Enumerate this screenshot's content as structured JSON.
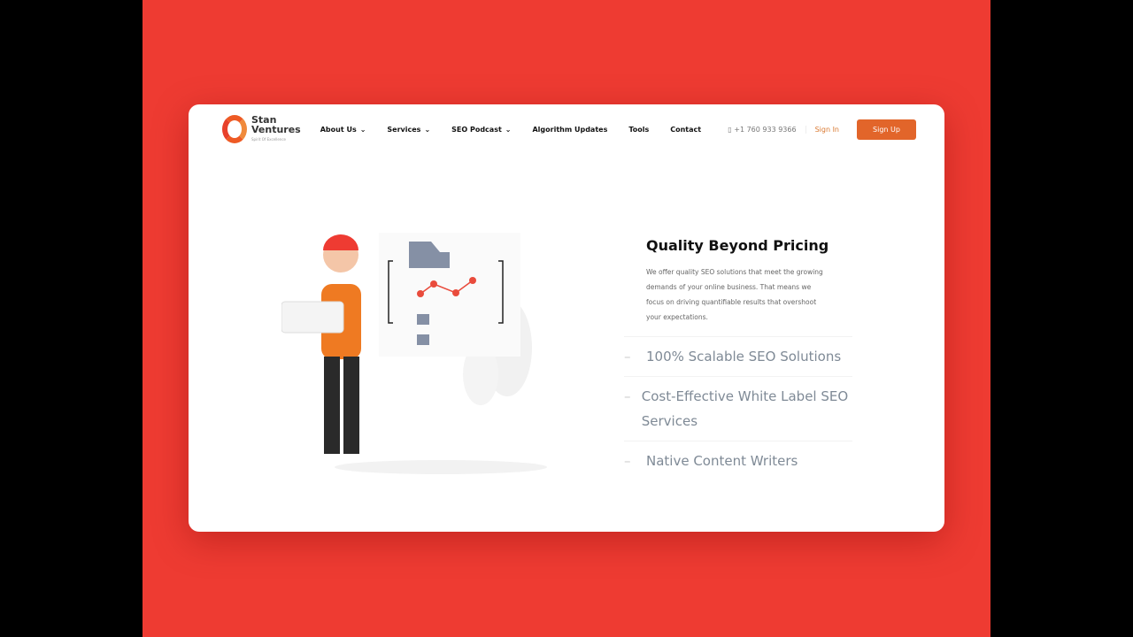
{
  "brand": {
    "name_line1": "Stan",
    "name_line2": "Ventures",
    "tagline": "Spirit Of Excellence"
  },
  "nav": {
    "items": [
      {
        "label": "About Us",
        "dropdown": true
      },
      {
        "label": "Services",
        "dropdown": true
      },
      {
        "label": "SEO Podcast",
        "dropdown": true
      },
      {
        "label": "Algorithm Updates"
      },
      {
        "label": "Tools"
      },
      {
        "label": "Contact"
      }
    ],
    "phone": "+1 760 933 9366",
    "sign_in": "Sign In",
    "sign_up": "Sign Up"
  },
  "hero": {
    "title": "Quality Beyond Pricing",
    "description": "We offer quality SEO solutions that meet the growing demands of your online business. That means we focus on driving quantifiable results that overshoot your expectations.",
    "features": [
      "100% Scalable SEO Solutions",
      "Cost-Effective White Label SEO Services",
      "Native Content Writers"
    ]
  },
  "colors": {
    "background": "#ee3b32",
    "accent": "#e2652a"
  }
}
